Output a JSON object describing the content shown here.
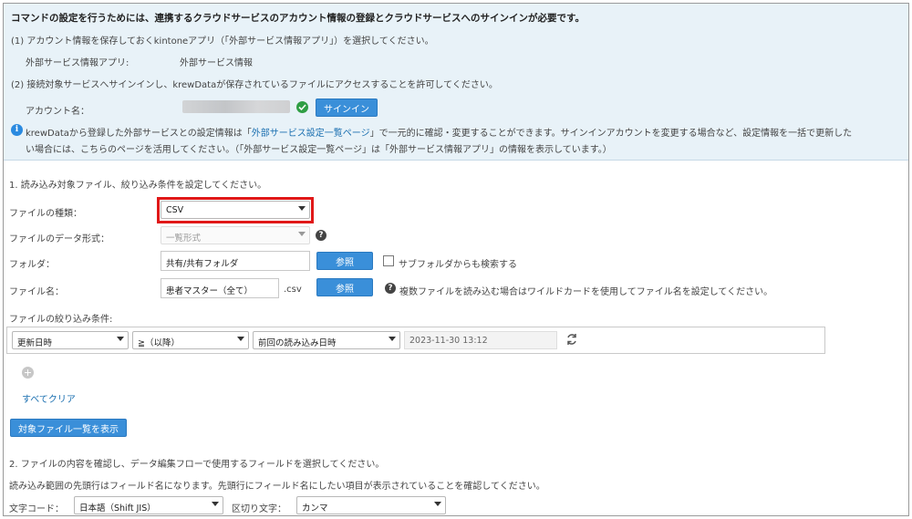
{
  "signin_section": {
    "heading": "コマンドの設定を行うためには、連携するクラウドサービスのアカウント情報の登録とクラウドサービスへのサインインが必要です。",
    "step1": "(1) アカウント情報を保存しておくkintoneアプリ（「外部サービス情報アプリ」）を選択してください。",
    "app_label": "外部サービス情報アプリ:",
    "app_value": "外部サービス情報",
    "step2": "(2) 接続対象サービスへサインインし、krewDataが保存されているファイルにアクセスすることを許可してください。",
    "account_label": "アカウント名：",
    "signin_button": "サインイン",
    "note_prefix": "krewDataから登録した外部サービスとの設定情報は「",
    "note_link": "外部サービス設定一覧ページ",
    "note_suffix": "」で一元的に確認・変更することができます。サインインアカウントを変更する場合など、設定情報を一括で更新した",
    "note_line2": "い場合には、こちらのページを活用してください。（「外部サービス設定一覧ページ」は「外部サービス情報アプリ」の情報を表示しています。）"
  },
  "file_section": {
    "title": "1. 読み込み対象ファイル、絞り込み条件を設定してください。",
    "file_type_label": "ファイルの種類：",
    "file_type_value": "CSV",
    "data_format_label": "ファイルのデータ形式：",
    "data_format_value": "一覧形式",
    "folder_label": "フォルダ：",
    "folder_value": "共有/共有フォルダ",
    "browse_label": "参照",
    "subfolder_label": "サブフォルダからも検索する",
    "filename_label": "ファイル名：",
    "filename_value": "患者マスター（全て）",
    "filename_ext": ".csv",
    "wildcard_hint": "複数ファイルを読み込む場合はワイルドカードを使用してファイル名を設定してください。",
    "filter_label": "ファイルの絞り込み条件:",
    "filter": {
      "field": "更新日時",
      "operator": "≧（以降）",
      "value_type": "前回の読み込み日時",
      "value": "2023-11-30 13:12"
    },
    "clear_all": "すべてクリア",
    "show_files_button": "対象ファイル一覧を表示"
  },
  "field_section": {
    "title": "2. ファイルの内容を確認し、データ編集フローで使用するフィールドを選択してください。",
    "note": "読み込み範囲の先頭行はフィールド名になります。先頭行にフィールド名にしたい項目が表示されていることを確認してください。",
    "encoding_label": "文字コード：",
    "encoding_value": "日本語（Shift JIS）",
    "delimiter_label": "区切り文字：",
    "delimiter_value": "カンマ"
  }
}
